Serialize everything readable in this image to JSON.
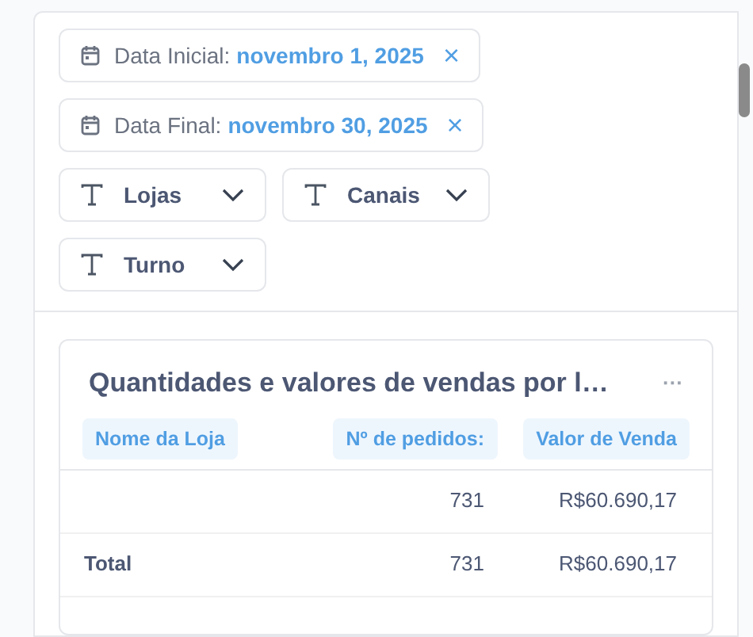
{
  "date_filters": [
    {
      "label": "Data Inicial:",
      "value": "novembro 1, 2025",
      "clear": "×"
    },
    {
      "label": "Data Final:",
      "value": "novembro 30, 2025",
      "clear": "×"
    }
  ],
  "select_filters": [
    {
      "label": "Lojas"
    },
    {
      "label": "Canais"
    },
    {
      "label": "Turno"
    }
  ],
  "card": {
    "title": "Quantidades e valores de vendas por l…",
    "menu": "···",
    "columns": [
      "Nome da Loja",
      "Nº de pedidos:",
      "Valor de Venda"
    ],
    "rows": [
      [
        "",
        "731",
        "R$60.690,17"
      ],
      [
        "Total",
        "731",
        "R$60.690,17"
      ]
    ]
  }
}
